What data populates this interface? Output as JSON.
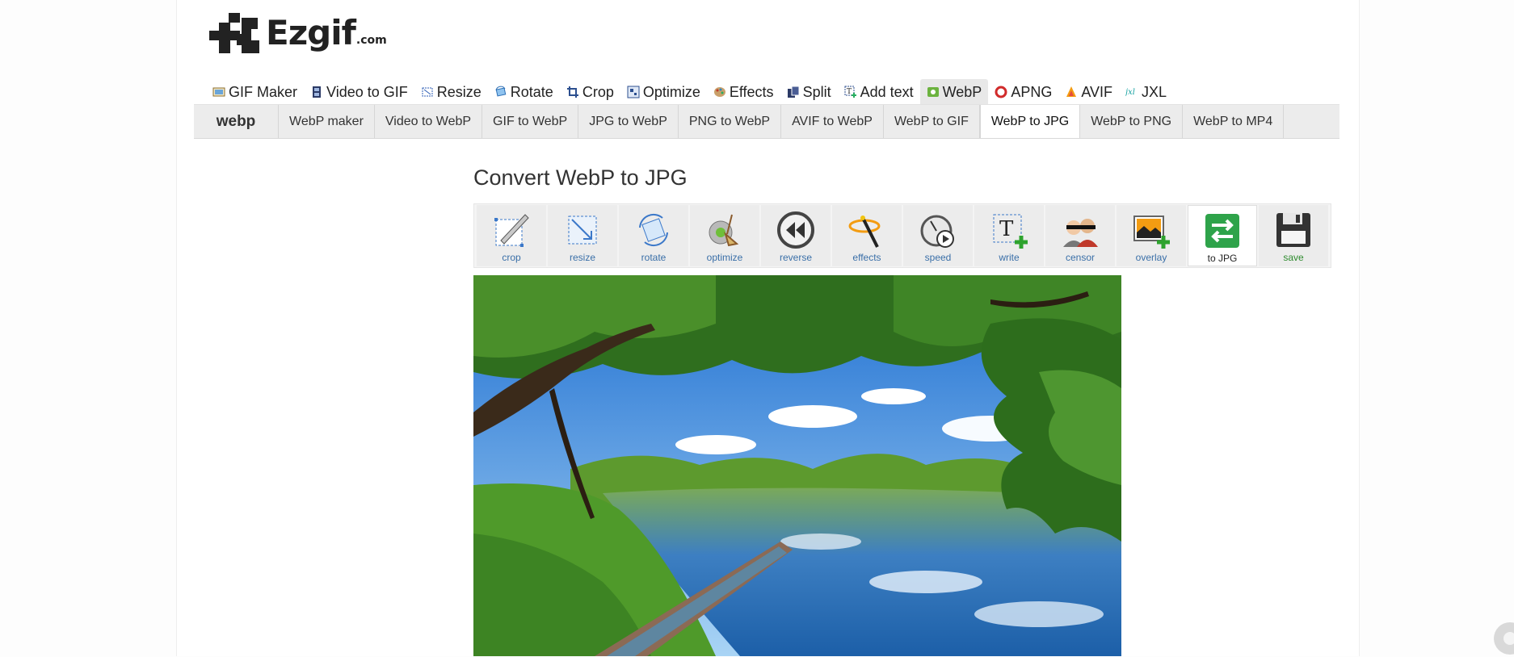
{
  "brand": {
    "logo_text": "Ezgif",
    "logo_tld": ".com"
  },
  "main_nav": [
    {
      "label": "GIF Maker",
      "icon": "gif-maker-icon"
    },
    {
      "label": "Video to GIF",
      "icon": "film-icon"
    },
    {
      "label": "Resize",
      "icon": "resize-icon"
    },
    {
      "label": "Rotate",
      "icon": "rotate-icon"
    },
    {
      "label": "Crop",
      "icon": "crop-icon"
    },
    {
      "label": "Optimize",
      "icon": "optimize-icon"
    },
    {
      "label": "Effects",
      "icon": "palette-icon"
    },
    {
      "label": "Split",
      "icon": "split-icon"
    },
    {
      "label": "Add text",
      "icon": "add-text-icon"
    },
    {
      "label": "WebP",
      "icon": "webp-icon",
      "active": true
    },
    {
      "label": "APNG",
      "icon": "apng-icon"
    },
    {
      "label": "AVIF",
      "icon": "avif-icon"
    },
    {
      "label": "JXL",
      "icon": "jxl-icon"
    }
  ],
  "sub_nav": {
    "brand": "webp",
    "items": [
      {
        "label": "WebP maker"
      },
      {
        "label": "Video to WebP"
      },
      {
        "label": "GIF to WebP"
      },
      {
        "label": "JPG to WebP"
      },
      {
        "label": "PNG to WebP"
      },
      {
        "label": "AVIF to WebP"
      },
      {
        "label": "WebP to GIF"
      },
      {
        "label": "WebP to JPG",
        "active": true
      },
      {
        "label": "WebP to PNG"
      },
      {
        "label": "WebP to MP4"
      }
    ]
  },
  "page": {
    "title": "Convert WebP to JPG"
  },
  "toolbar": [
    {
      "label": "crop",
      "icon": "crop-tool-icon"
    },
    {
      "label": "resize",
      "icon": "resize-tool-icon"
    },
    {
      "label": "rotate",
      "icon": "rotate-tool-icon"
    },
    {
      "label": "optimize",
      "icon": "optimize-tool-icon"
    },
    {
      "label": "reverse",
      "icon": "reverse-tool-icon"
    },
    {
      "label": "effects",
      "icon": "effects-tool-icon"
    },
    {
      "label": "speed",
      "icon": "speed-tool-icon"
    },
    {
      "label": "write",
      "icon": "write-tool-icon"
    },
    {
      "label": "censor",
      "icon": "censor-tool-icon"
    },
    {
      "label": "overlay",
      "icon": "overlay-tool-icon"
    },
    {
      "label": "to JPG",
      "icon": "to-jpg-tool-icon",
      "active": true
    },
    {
      "label": "save",
      "icon": "save-tool-icon"
    }
  ],
  "colors": {
    "accent_blue": "#3a6fa8",
    "accent_green": "#2e8b2e",
    "nav_active_bg": "#e8e8e8",
    "subnav_bg": "#ececec"
  }
}
